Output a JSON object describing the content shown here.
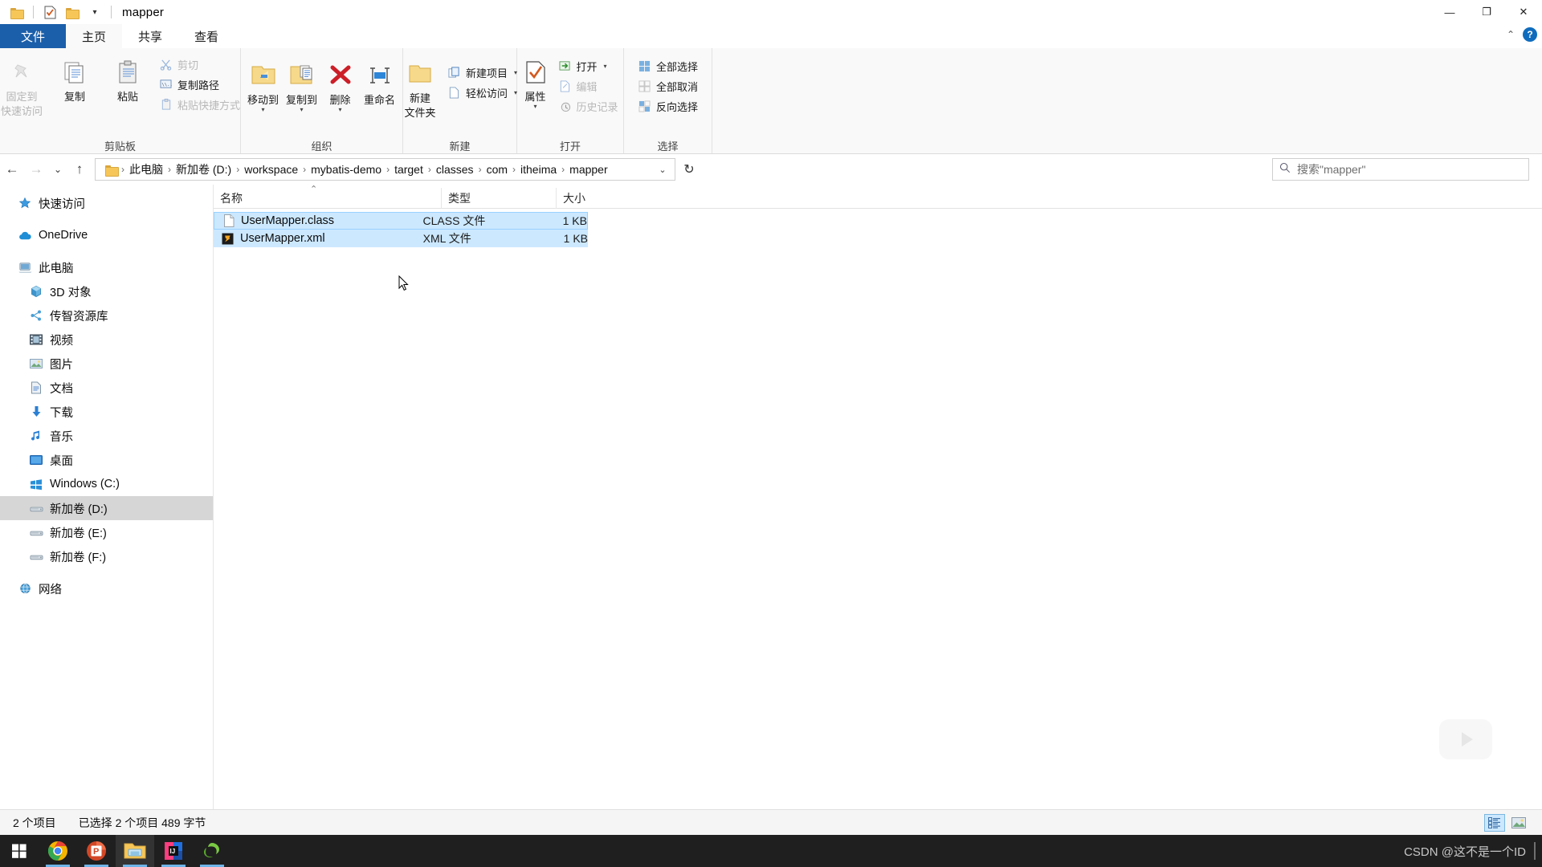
{
  "window": {
    "title": "mapper",
    "qat": [
      {
        "name": "qat-folder-icon",
        "label": "文件夹"
      },
      {
        "name": "qat-properties-icon",
        "label": "属性"
      },
      {
        "name": "qat-new-folder-icon",
        "label": "新建文件夹"
      }
    ],
    "qat_dropdown": "▾",
    "controls": {
      "minimize": "—",
      "maximize": "❐",
      "close": "✕"
    }
  },
  "tabs": {
    "file": "文件",
    "items": [
      {
        "label": "主页",
        "active": true
      },
      {
        "label": "共享",
        "active": false
      },
      {
        "label": "查看",
        "active": false
      }
    ],
    "collapse": "⌃",
    "help": "?"
  },
  "ribbon": {
    "groups": [
      {
        "label": "剪贴板",
        "big": [
          {
            "label_line1": "固定到",
            "label_line2": "快速访问",
            "icon": "pin-icon",
            "dim": true
          },
          {
            "label_line1": "复制",
            "label_line2": "",
            "icon": "copy-icon",
            "dim": false
          },
          {
            "label_line1": "粘贴",
            "label_line2": "",
            "icon": "paste-icon",
            "dim": false
          }
        ],
        "small": [
          {
            "label": "剪切",
            "icon": "scissors-icon",
            "dim": true
          },
          {
            "label": "复制路径",
            "icon": "copy-path-icon",
            "dim": false
          },
          {
            "label": "粘贴快捷方式",
            "icon": "paste-shortcut-icon",
            "dim": true
          }
        ]
      },
      {
        "label": "组织",
        "big": [
          {
            "label_line1": "移动到",
            "label_line2": "",
            "icon": "move-to-icon",
            "caret": "▾"
          },
          {
            "label_line1": "复制到",
            "label_line2": "",
            "icon": "copy-to-icon",
            "caret": "▾"
          },
          {
            "label_line1": "删除",
            "label_line2": "",
            "icon": "delete-icon",
            "caret": "▾"
          },
          {
            "label_line1": "重命名",
            "label_line2": "",
            "icon": "rename-icon",
            "caret": ""
          }
        ],
        "small": []
      },
      {
        "label": "新建",
        "big": [
          {
            "label_line1": "新建",
            "label_line2": "文件夹",
            "icon": "new-folder-icon",
            "caret": ""
          }
        ],
        "small": [
          {
            "label": "新建项目",
            "icon": "new-item-icon",
            "caret": "▾",
            "dim": false
          },
          {
            "label": "轻松访问",
            "icon": "easy-access-icon",
            "caret": "▾",
            "dim": false
          }
        ]
      },
      {
        "label": "打开",
        "big": [
          {
            "label_line1": "属性",
            "label_line2": "",
            "icon": "properties-icon",
            "caret": "▾"
          }
        ],
        "small": [
          {
            "label": "打开",
            "icon": "open-icon",
            "caret": "▾",
            "dim": false
          },
          {
            "label": "编辑",
            "icon": "edit-icon",
            "caret": "",
            "dim": true
          },
          {
            "label": "历史记录",
            "icon": "history-icon",
            "caret": "",
            "dim": true
          }
        ]
      },
      {
        "label": "选择",
        "big": [],
        "small": [
          {
            "label": "全部选择",
            "icon": "select-all-icon",
            "dim": false
          },
          {
            "label": "全部取消",
            "icon": "select-none-icon",
            "dim": false
          },
          {
            "label": "反向选择",
            "icon": "invert-selection-icon",
            "dim": false
          }
        ]
      }
    ]
  },
  "address": {
    "back": "←",
    "forward": "→",
    "recent": "⌄",
    "up": "↑",
    "crumbs": [
      "此电脑",
      "新加卷 (D:)",
      "workspace",
      "mybatis-demo",
      "target",
      "classes",
      "com",
      "itheima",
      "mapper"
    ],
    "separator": "›",
    "dropdown": "⌄",
    "refresh": "↻"
  },
  "search": {
    "placeholder": "搜索\"mapper\"",
    "icon": "search-icon"
  },
  "navpane": {
    "items": [
      {
        "label": "快速访问",
        "icon": "star-icon",
        "indent": 0,
        "selected": false
      },
      {
        "label": "OneDrive",
        "icon": "cloud-icon",
        "indent": 0,
        "selected": false
      },
      {
        "label": "此电脑",
        "icon": "this-pc-icon",
        "indent": 0,
        "selected": false
      },
      {
        "label": "3D 对象",
        "icon": "3d-objects-icon",
        "indent": 1,
        "selected": false
      },
      {
        "label": "传智资源库",
        "icon": "library-icon",
        "indent": 1,
        "selected": false
      },
      {
        "label": "视频",
        "icon": "videos-icon",
        "indent": 1,
        "selected": false
      },
      {
        "label": "图片",
        "icon": "pictures-icon",
        "indent": 1,
        "selected": false
      },
      {
        "label": "文档",
        "icon": "documents-icon",
        "indent": 1,
        "selected": false
      },
      {
        "label": "下载",
        "icon": "downloads-icon",
        "indent": 1,
        "selected": false
      },
      {
        "label": "音乐",
        "icon": "music-icon",
        "indent": 1,
        "selected": false
      },
      {
        "label": "桌面",
        "icon": "desktop-icon",
        "indent": 1,
        "selected": false
      },
      {
        "label": "Windows (C:)",
        "icon": "windows-drive-icon",
        "indent": 1,
        "selected": false
      },
      {
        "label": "新加卷 (D:)",
        "icon": "drive-icon",
        "indent": 1,
        "selected": true
      },
      {
        "label": "新加卷 (E:)",
        "icon": "drive-icon",
        "indent": 1,
        "selected": false
      },
      {
        "label": "新加卷 (F:)",
        "icon": "drive-icon",
        "indent": 1,
        "selected": false
      },
      {
        "label": "网络",
        "icon": "network-icon",
        "indent": 0,
        "selected": false
      }
    ]
  },
  "filelist": {
    "columns": [
      {
        "label": "名称",
        "sorted": true,
        "sort_glyph": "⌃"
      },
      {
        "label": "类型",
        "sorted": false
      },
      {
        "label": "大小",
        "sorted": false
      }
    ],
    "rows": [
      {
        "name": "UserMapper.class",
        "type": "CLASS 文件",
        "size": "1 KB",
        "icon": "generic-file-icon",
        "selected": true,
        "focused": true
      },
      {
        "name": "UserMapper.xml",
        "type": "XML 文件",
        "size": "1 KB",
        "icon": "xml-file-icon",
        "selected": true,
        "focused": false
      }
    ]
  },
  "statusbar": {
    "item_count": "2 个项目",
    "selection": "已选择 2 个项目  489 字节",
    "views": [
      {
        "name": "details-view",
        "active": true
      },
      {
        "name": "large-icons-view",
        "active": false
      }
    ]
  },
  "taskbar": {
    "items": [
      {
        "name": "start-button",
        "label": "开始",
        "active": false,
        "running": false
      },
      {
        "name": "chrome-taskbar-icon",
        "label": "Google Chrome",
        "active": false,
        "running": true
      },
      {
        "name": "powerpoint-taskbar-icon",
        "label": "PowerPoint",
        "active": false,
        "running": true
      },
      {
        "name": "file-explorer-taskbar-icon",
        "label": "文件资源管理器",
        "active": true,
        "running": true
      },
      {
        "name": "intellij-taskbar-icon",
        "label": "IntelliJ IDEA",
        "active": false,
        "running": true
      },
      {
        "name": "navicat-taskbar-icon",
        "label": "Navicat",
        "active": false,
        "running": true
      }
    ],
    "watermark": "CSDN @这不是一个ID"
  },
  "colors": {
    "accent": "#1b5faa",
    "selection": "#cce8ff",
    "nav_selection": "#d6d6d6",
    "ribbon_bg": "#f9f9f9",
    "taskbar_bg": "#1f1f1f"
  }
}
